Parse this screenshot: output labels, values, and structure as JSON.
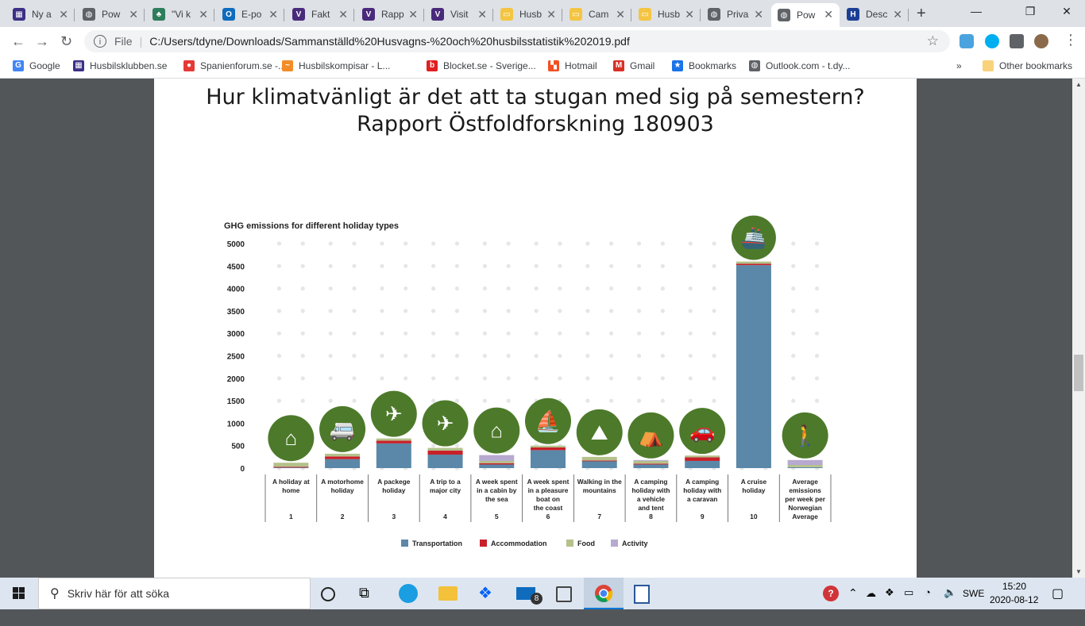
{
  "browser": {
    "tabs": [
      {
        "label": "Ny a",
        "color": "#3b2f86",
        "glyph": "▦"
      },
      {
        "label": "Pow",
        "color": "#5f6368",
        "glyph": "◍"
      },
      {
        "label": "\"Vi k",
        "color": "#2e7d5b",
        "glyph": "♣"
      },
      {
        "label": "E-po",
        "color": "#0f6cbd",
        "glyph": "O"
      },
      {
        "label": "Fakt",
        "color": "#4a2a7a",
        "glyph": "V"
      },
      {
        "label": "Rapp",
        "color": "#4a2a7a",
        "glyph": "V"
      },
      {
        "label": "Visit",
        "color": "#4a2a7a",
        "glyph": "V"
      },
      {
        "label": "Husb",
        "color": "#f4c542",
        "glyph": "▭"
      },
      {
        "label": "Cam",
        "color": "#f4c542",
        "glyph": "▭"
      },
      {
        "label": "Husb",
        "color": "#f4c542",
        "glyph": "▭"
      },
      {
        "label": "Priva",
        "color": "#5f6368",
        "glyph": "◍"
      },
      {
        "label": "Pow",
        "color": "#5f6368",
        "glyph": "◍",
        "active": true
      },
      {
        "label": "Desc",
        "color": "#1c3f94",
        "glyph": "H"
      }
    ],
    "address": {
      "scheme_label": "File",
      "url": "C:/Users/tdyne/Downloads/Sammanställd%20Husvagns-%20och%20husbilsstatistik%202019.pdf"
    },
    "bookmarks": [
      {
        "label": "Google",
        "color": "#4285f4",
        "glyph": "G"
      },
      {
        "label": "Husbilsklubben.se",
        "color": "#3b2f86",
        "glyph": "▦"
      },
      {
        "label": "Spanienforum.se -...",
        "color": "#e53935",
        "glyph": "●"
      },
      {
        "label": "Husbilskompisar - L...",
        "color": "#f28c28",
        "glyph": "~"
      },
      {
        "label": "Blocket.se - Sverige...",
        "color": "#e02020",
        "glyph": "b"
      },
      {
        "label": "Hotmail",
        "color": "#f25022",
        "glyph": "▚"
      },
      {
        "label": "Gmail",
        "color": "#d93025",
        "glyph": "M"
      },
      {
        "label": "Bookmarks",
        "color": "#1a73e8",
        "glyph": "★"
      },
      {
        "label": "Outlook.com - t.dy...",
        "color": "#5f6368",
        "glyph": "◍"
      }
    ],
    "other_bookmarks": "Other bookmarks",
    "overflow": "»"
  },
  "document": {
    "title_line1": "Hur klimatvänligt är det att ta stugan med sig på semestern?",
    "title_line2": "Rapport Östfoldforskning 180903"
  },
  "chart_data": {
    "type": "bar",
    "stacked": true,
    "title": "GHG emissions for different holiday types",
    "ylim": [
      0,
      5000
    ],
    "yticks": [
      0,
      500,
      1000,
      1500,
      2000,
      2500,
      3000,
      3500,
      4000,
      4500,
      5000
    ],
    "grid": "dots",
    "legend_position": "bottom",
    "categories": [
      {
        "label": [
          "A holiday at",
          "home"
        ],
        "number": "1",
        "icon": "house-icon"
      },
      {
        "label": [
          "A motorhome",
          "holiday"
        ],
        "number": "2",
        "icon": "motorhome-icon"
      },
      {
        "label": [
          "A packege",
          "holiday"
        ],
        "number": "3",
        "icon": "plane-palm-icon"
      },
      {
        "label": [
          "A trip to a",
          "major city"
        ],
        "number": "4",
        "icon": "plane-city-icon"
      },
      {
        "label": [
          "A week spent",
          "in a cabin by",
          "the sea"
        ],
        "number": "5",
        "icon": "cabin-boat-icon"
      },
      {
        "label": [
          "A week spent",
          "in a pleasure",
          "boat on",
          "the coast"
        ],
        "number": "6",
        "icon": "boat-coast-icon"
      },
      {
        "label": [
          "Walking in the",
          "mountains"
        ],
        "number": "7",
        "icon": "hiker-icon"
      },
      {
        "label": [
          "A camping",
          "holiday with",
          "a vehicle",
          "and tent"
        ],
        "number": "8",
        "icon": "tent-car-icon"
      },
      {
        "label": [
          "A camping",
          "holiday with",
          "a caravan"
        ],
        "number": "9",
        "icon": "car-caravan-icon"
      },
      {
        "label": [
          "A cruise",
          "holiday"
        ],
        "number": "10",
        "icon": "cruise-ship-icon"
      },
      {
        "label": [
          "Average",
          "emissions",
          "per week per",
          "Norwegian",
          "Average"
        ],
        "number": "",
        "icon": "person-flag-icon"
      }
    ],
    "series": [
      {
        "name": "Transportation",
        "color": "#5b88a8",
        "values": [
          20,
          200,
          550,
          300,
          80,
          400,
          160,
          80,
          160,
          4520,
          20
        ]
      },
      {
        "name": "Accommodation",
        "color": "#c8202a",
        "values": [
          10,
          60,
          60,
          90,
          30,
          60,
          10,
          20,
          80,
          30,
          0
        ]
      },
      {
        "name": "Food",
        "color": "#b4c18a",
        "values": [
          90,
          60,
          50,
          60,
          50,
          40,
          80,
          60,
          40,
          50,
          50
        ]
      },
      {
        "name": "Activity",
        "color": "#b7a9cf",
        "values": [
          0,
          0,
          0,
          0,
          130,
          0,
          0,
          20,
          0,
          0,
          110
        ]
      }
    ]
  },
  "taskbar": {
    "search_placeholder": "Skriv här för att söka",
    "mail_badge": "8",
    "language": "SWE",
    "time": "15:20",
    "date": "2020-08-12"
  }
}
